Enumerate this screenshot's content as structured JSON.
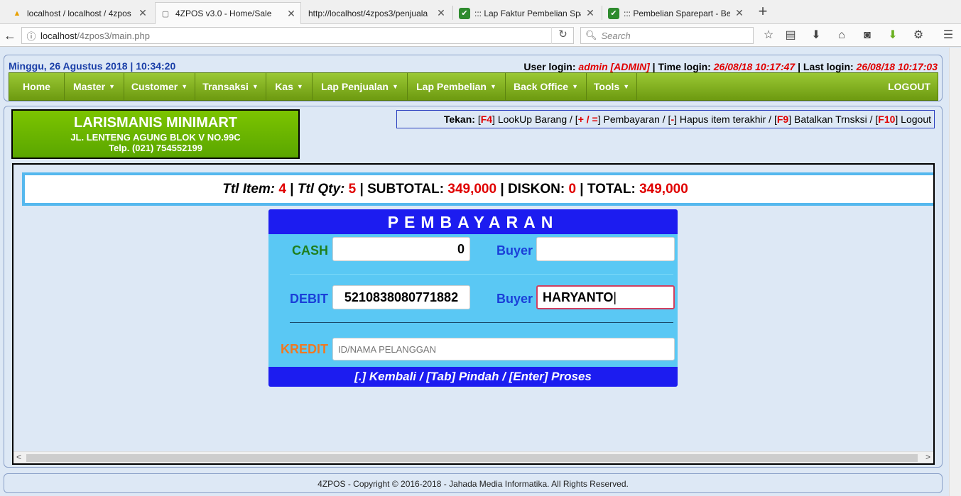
{
  "browser": {
    "tabs": [
      {
        "title": "localhost / localhost / 4zpos",
        "icon": "pma-icon",
        "icon_glyph": "▲"
      },
      {
        "title": "4ZPOS v3.0 - Home/Sale",
        "icon": "page-icon",
        "icon_glyph": "▢"
      },
      {
        "title": "http://localhost/4zpos3/penjuala",
        "icon": "none",
        "icon_glyph": ""
      },
      {
        "title": "::: Lap Faktur Pembelian Spa",
        "icon": "shield-icon",
        "icon_glyph": "✔"
      },
      {
        "title": "::: Pembelian Sparepart - Ber",
        "icon": "shield-icon",
        "icon_glyph": "✔"
      }
    ],
    "new_tab_glyph": "+",
    "url_host": "localhost",
    "url_path": "/4zpos3/main.php",
    "search_placeholder": "Search"
  },
  "header": {
    "datetime": "Minggu, 26 Agustus 2018 | 10:34:20",
    "user_login_label": "User login:",
    "user_login_value": "admin [ADMIN]",
    "time_login_label": "Time login:",
    "time_login_value": "26/08/18 10:17:47",
    "last_login_label": "Last login:",
    "last_login_value": "26/08/18 10:17:03"
  },
  "menu": {
    "items": [
      {
        "label": "Home",
        "dropdown": false
      },
      {
        "label": "Master",
        "dropdown": true
      },
      {
        "label": "Customer",
        "dropdown": true
      },
      {
        "label": "Transaksi",
        "dropdown": true
      },
      {
        "label": "Kas",
        "dropdown": true
      },
      {
        "label": "Lap Penjualan",
        "dropdown": true
      },
      {
        "label": "Lap Pembelian",
        "dropdown": true
      },
      {
        "label": "Back Office",
        "dropdown": true
      },
      {
        "label": "Tools",
        "dropdown": true
      }
    ],
    "logout": "LOGOUT"
  },
  "store": {
    "name": "LARISMANIS MINIMART",
    "address": "JL. LENTENG AGUNG BLOK V NO.99C",
    "phone": "Telp. (021) 754552199"
  },
  "hotkeys": {
    "prefix": "Tekan: ",
    "items": [
      {
        "key": "F4",
        "desc": "LookUp Barang"
      },
      {
        "key": "+ / =",
        "desc": "Pembayaran"
      },
      {
        "key": "-",
        "desc": "Hapus item terakhir"
      },
      {
        "key": "F9",
        "desc": "Batalkan Trnsksi"
      },
      {
        "key": "F10",
        "desc": "Logout"
      }
    ]
  },
  "summary": {
    "ttl_item_label": "Ttl Item:",
    "ttl_item_value": "4",
    "ttl_qty_label": "Ttl Qty:",
    "ttl_qty_value": "5",
    "subtotal_label": "SUBTOTAL:",
    "subtotal_value": "349,000",
    "diskon_label": "DISKON:",
    "diskon_value": "0",
    "total_label": "TOTAL:",
    "total_value": "349,000"
  },
  "payment": {
    "title": "PEMBAYARAN",
    "cash_label": "CASH",
    "cash_value": "0",
    "cash_buyer_label": "Buyer",
    "cash_buyer_value": "",
    "debit_label": "DEBIT",
    "debit_value": "5210838080771882",
    "debit_buyer_label": "Buyer",
    "debit_buyer_value": "HARYANTO",
    "kredit_label": "KREDIT",
    "kredit_placeholder": "ID/NAMA PELANGGAN",
    "footer": "[.] Kembali / [Tab] Pindah / [Enter] Proses",
    "colors": {
      "cash": "#1f7f1f",
      "debit": "#1a3fd8",
      "kredit": "#f07820",
      "buyer": "#1a3fd8",
      "panel": "#5ac8f4",
      "header": "#1c1cf0"
    }
  },
  "footer": {
    "copyright": "4ZPOS - Copyright © 2016-2018 - Jahada Media Informatika. All Rights Reserved."
  }
}
